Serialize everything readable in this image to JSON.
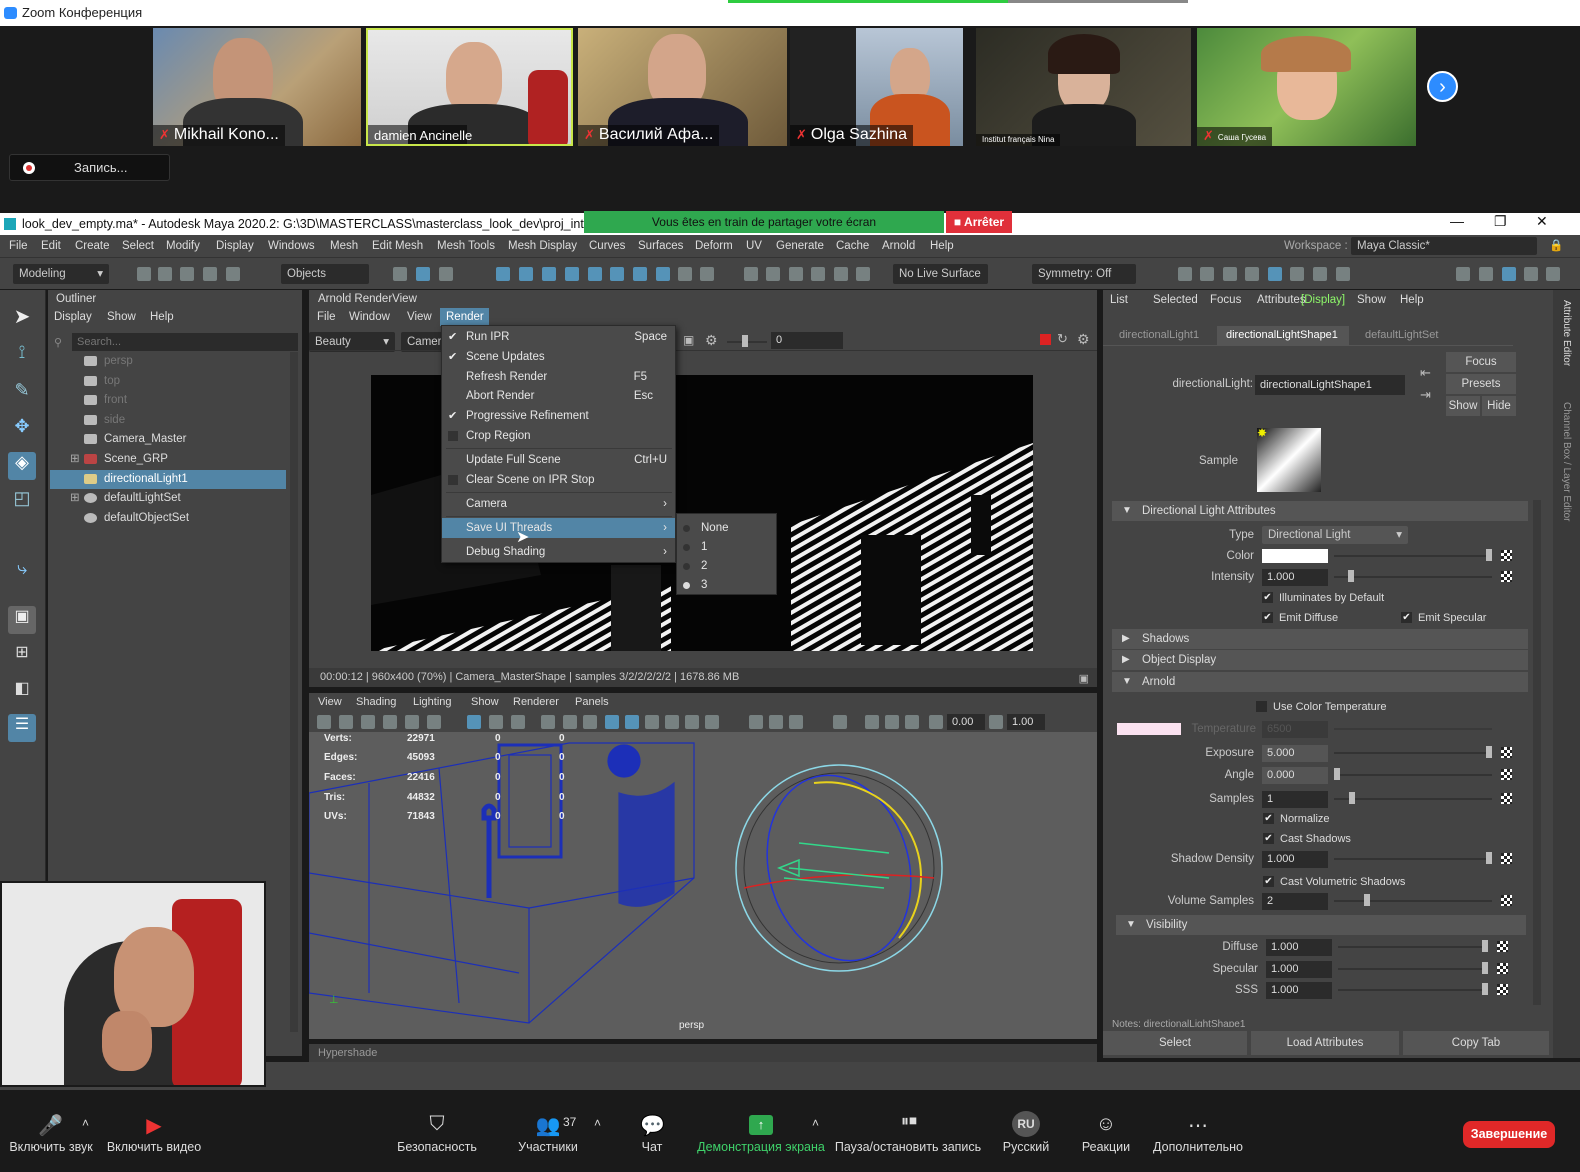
{
  "zoom": {
    "window_title": "Zoom Конференция",
    "participants": [
      {
        "name": "Mikhail Kono...",
        "muted": true
      },
      {
        "name": "damien Ancinelle",
        "muted": false
      },
      {
        "name": "Василий Афа...",
        "muted": true
      },
      {
        "name": "Olga Sazhina",
        "muted": true
      },
      {
        "name": "Institut français Nina",
        "muted": false
      },
      {
        "name": "Саша Гусева",
        "muted": true
      }
    ],
    "recording_label": "Запись...",
    "share_banner": "Vous êtes en train de partager votre écran",
    "stop_share": "Arrêter",
    "bottom": {
      "mute": "Включить звук",
      "video": "Включить видео",
      "security": "Безопасность",
      "participants": "Участники",
      "participants_count": "37",
      "chat": "Чат",
      "share": "Демонстрация экрана",
      "pause_record": "Пауза/остановить запись",
      "language": "Русский",
      "language_badge": "RU",
      "reactions": "Реакции",
      "more": "Дополнительно",
      "end": "Завершение"
    },
    "colors": {
      "accent": "#2d8cff",
      "share_green": "#2fa84f",
      "end_red": "#e02828"
    }
  },
  "maya": {
    "title": "look_dev_empty.ma* - Autodesk Maya 2020.2: G:\\3D\\MASTERCLASS\\masterclass_look_dev\\proj_int\\scenes\\l",
    "menu": [
      "File",
      "Edit",
      "Create",
      "Select",
      "Modify",
      "Display",
      "Windows",
      "Mesh",
      "Edit Mesh",
      "Mesh Tools",
      "Mesh Display",
      "Curves",
      "Surfaces",
      "Deform",
      "UV",
      "Generate",
      "Cache",
      "Arnold",
      "Help"
    ],
    "workspace_label": "Workspace :",
    "workspace_value": "Maya Classic*",
    "toolbar": {
      "mode": "Modeling",
      "objects": "Objects",
      "live_surface": "No Live Surface",
      "symmetry": "Symmetry: Off"
    },
    "outliner": {
      "title": "Outliner",
      "menu": [
        "Display",
        "Show",
        "Help"
      ],
      "search_placeholder": "Search...",
      "items": [
        {
          "label": "persp",
          "dim": true
        },
        {
          "label": "top",
          "dim": true
        },
        {
          "label": "front",
          "dim": true
        },
        {
          "label": "side",
          "dim": true
        },
        {
          "label": "Camera_Master",
          "dim": false
        },
        {
          "label": "Scene_GRP",
          "dim": false
        },
        {
          "label": "directionalLight1",
          "dim": false,
          "selected": true
        },
        {
          "label": "defaultLightSet",
          "dim": false
        },
        {
          "label": "defaultObjectSet",
          "dim": false
        }
      ]
    },
    "renderview": {
      "title": "Arnold RenderView",
      "menu": [
        "File",
        "Window",
        "View",
        "Render"
      ],
      "aov": "Beauty",
      "camera": "Camer",
      "exposure": "0",
      "status": "00:00:12 | 960x400 (70%) | Camera_MasterShape | samples 3/2/2/2/2/2 | 1678.86 MB",
      "render_menu": [
        {
          "label": "Run IPR",
          "shortcut": "Space",
          "check": "on"
        },
        {
          "label": "Scene Updates",
          "shortcut": "",
          "check": "on"
        },
        {
          "label": "Refresh Render",
          "shortcut": "F5",
          "check": ""
        },
        {
          "label": "Abort Render",
          "shortcut": "Esc",
          "check": ""
        },
        {
          "label": "Progressive Refinement",
          "shortcut": "",
          "check": "on"
        },
        {
          "label": "Crop Region",
          "shortcut": "",
          "check": "off"
        },
        {
          "label": "Update Full Scene",
          "shortcut": "Ctrl+U",
          "check": ""
        },
        {
          "label": "Clear Scene on IPR Stop",
          "shortcut": "",
          "check": "off"
        },
        {
          "label": "Camera",
          "shortcut": "",
          "check": "",
          "sub": true
        },
        {
          "label": "Save UI Threads",
          "shortcut": "",
          "check": "",
          "sub": true,
          "highlight": true
        },
        {
          "label": "Debug Shading",
          "shortcut": "",
          "check": "",
          "sub": true
        }
      ],
      "threads_submenu": [
        {
          "label": "None",
          "on": false
        },
        {
          "label": "1",
          "on": false
        },
        {
          "label": "2",
          "on": false
        },
        {
          "label": "3",
          "on": true
        }
      ]
    },
    "viewport": {
      "menu": [
        "View",
        "Shading",
        "Lighting",
        "Show",
        "Renderer",
        "Panels"
      ],
      "field1": "0.00",
      "field2": "1.00",
      "hud": [
        {
          "label": "Verts:",
          "value": "22971",
          "a": "0",
          "b": "0"
        },
        {
          "label": "Edges:",
          "value": "45093",
          "a": "0",
          "b": "0"
        },
        {
          "label": "Faces:",
          "value": "22416",
          "a": "0",
          "b": "0"
        },
        {
          "label": "Tris:",
          "value": "44832",
          "a": "0",
          "b": "0"
        },
        {
          "label": "UVs:",
          "value": "71843",
          "a": "0",
          "b": "0"
        }
      ],
      "camera_label": "persp",
      "hypershade": "Hypershade"
    },
    "attribute_editor": {
      "menu": [
        "List",
        "Selected",
        "Focus",
        "Attributes",
        "Display",
        "Show",
        "Help"
      ],
      "tabs": [
        "directionalLight1",
        "directionalLightShape1",
        "defaultLightSet"
      ],
      "node_label": "directionalLight:",
      "node_value": "directionalLightShape1",
      "focus": "Focus",
      "presets": "Presets",
      "show": "Show",
      "hide": "Hide",
      "sample_label": "Sample",
      "sections": {
        "directional": "Directional Light Attributes",
        "shadows": "Shadows",
        "object_display": "Object Display",
        "arnold": "Arnold",
        "visibility": "Visibility"
      },
      "type_label": "Type",
      "type_value": "Directional Light",
      "color_label": "Color",
      "intensity_label": "Intensity",
      "intensity_value": "1.000",
      "illuminates": "Illuminates by Default",
      "emit_diffuse": "Emit Diffuse",
      "emit_specular": "Emit Specular",
      "use_color_temp": "Use Color Temperature",
      "temperature_label": "Temperature",
      "temperature_value": "6500",
      "exposure_label": "Exposure",
      "exposure_value": "5.000",
      "angle_label": "Angle",
      "angle_value": "0.000",
      "samples_label": "Samples",
      "samples_value": "1",
      "normalize": "Normalize",
      "cast_shadows": "Cast Shadows",
      "shadow_density_label": "Shadow Density",
      "shadow_density_value": "1.000",
      "cast_vol_shadows": "Cast Volumetric Shadows",
      "volume_samples_label": "Volume Samples",
      "volume_samples_value": "2",
      "diffuse_label": "Diffuse",
      "diffuse_value": "1.000",
      "specular_label": "Specular",
      "specular_value": "1.000",
      "sss_label": "SSS",
      "sss_value": "1.000",
      "notes": "Notes: directionalLightShape1",
      "btn_select": "Select",
      "btn_load": "Load Attributes",
      "btn_copy": "Copy Tab",
      "side_tab1": "Attribute Editor",
      "side_tab2": "Channel Box / Layer Editor"
    }
  }
}
